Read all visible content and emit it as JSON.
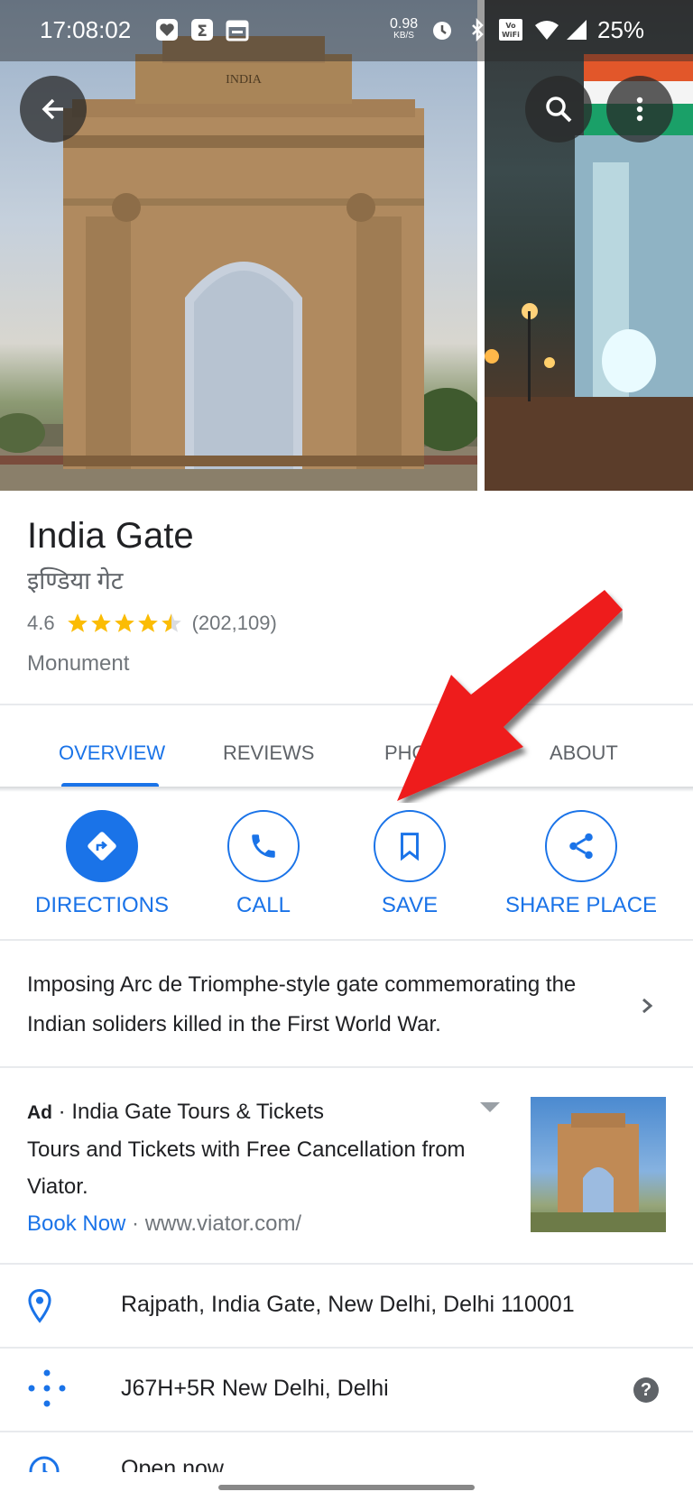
{
  "status_bar": {
    "time": "17:08:02",
    "speed_value": "0.98",
    "speed_unit": "KB/S",
    "battery": "25%",
    "icons": [
      "heart-app-icon",
      "sigma-app-icon",
      "calendar-icon",
      "alarm-icon",
      "bluetooth-icon",
      "vowifi-icon",
      "wifi-icon",
      "signal-icon"
    ]
  },
  "place": {
    "name": "India Gate",
    "name_local": "इण्डिया गेट",
    "rating": "4.6",
    "stars_filled": 4.5,
    "review_count": "(202,109)",
    "category": "Monument",
    "hero_inscription": "INDIA"
  },
  "tabs": [
    {
      "label": "OVERVIEW"
    },
    {
      "label": "REVIEWS"
    },
    {
      "label": "PHO"
    },
    {
      "label": "ABOUT"
    }
  ],
  "actions": {
    "directions": "DIRECTIONS",
    "call": "CALL",
    "save": "SAVE",
    "share": "SHARE PLACE"
  },
  "description": "Imposing Arc de Triomphe-style gate commemorating the Indian soliders killed in the First World War.",
  "ad": {
    "badge": "Ad",
    "separator": " · ",
    "title": "India Gate Tours & Tickets",
    "body": "Tours and Tickets with Free Cancellation from Viator.",
    "cta": "Book Now",
    "url": "www.viator.com/"
  },
  "info": {
    "address": "Rajpath, India Gate, New Delhi, Delhi 110001",
    "plus_code": "J67H+5R New Delhi, Delhi",
    "hours": "Open now"
  },
  "colors": {
    "accent": "#1a73e8",
    "star": "#fbbc04",
    "annotation_arrow": "#ee1b1b"
  }
}
